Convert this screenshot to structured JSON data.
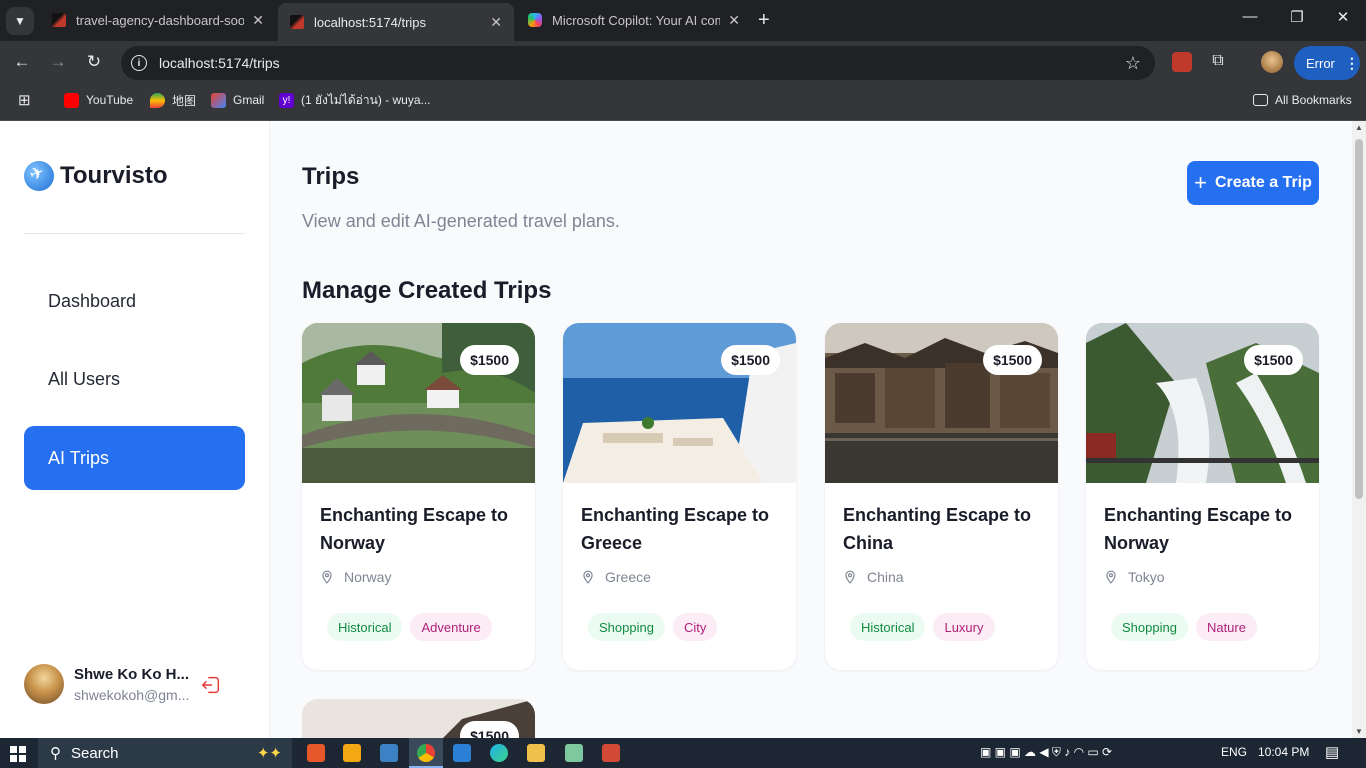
{
  "browser": {
    "tabs": [
      {
        "title": "travel-agency-dashboard-sooty",
        "close": "✕"
      },
      {
        "title": "localhost:5174/trips",
        "close": "✕"
      },
      {
        "title": "Microsoft Copilot: Your AI comp",
        "close": "✕"
      }
    ],
    "url": "localhost:5174/trips",
    "error_label": "Error",
    "bookmarks": [
      "YouTube",
      "地图",
      "Gmail",
      "(1 ยังไม่ได้อ่าน) - wuya...",
      "All Bookmarks"
    ]
  },
  "sidebar": {
    "brand": "Tourvisto",
    "items": [
      {
        "label": "Dashboard"
      },
      {
        "label": "All Users"
      },
      {
        "label": "AI Trips"
      }
    ],
    "user": {
      "name": "Shwe Ko Ko H...",
      "email": "shwekokoh@gm..."
    }
  },
  "header": {
    "title": "Trips",
    "subtitle": "View and edit AI-generated travel plans.",
    "create_button": "Create a Trip"
  },
  "section_title": "Manage Created Trips",
  "trips": [
    {
      "title_line1": "Enchanting Escape to",
      "title_line2": "Norway",
      "location": "Norway",
      "price": "$1500",
      "tags": [
        "Historical",
        "Adventure"
      ]
    },
    {
      "title_line1": "Enchanting Escape to",
      "title_line2": "Greece",
      "location": "Greece",
      "price": "$1500",
      "tags": [
        "Shopping",
        "City"
      ]
    },
    {
      "title_line1": "Enchanting Escape to",
      "title_line2": "China",
      "location": "China",
      "price": "$1500",
      "tags": [
        "Historical",
        "Luxury"
      ]
    },
    {
      "title_line1": "Enchanting Escape to",
      "title_line2": "Norway",
      "location": "Tokyo",
      "price": "$1500",
      "tags": [
        "Shopping",
        "Nature"
      ]
    }
  ],
  "partial_card_price": "$1500",
  "taskbar": {
    "search_label": "Search",
    "language": "ENG",
    "time": "10:04 PM"
  },
  "colors": {
    "accent": "#256ff1",
    "tag_green_bg": "#ecfbf1",
    "tag_green_text": "#0f8a3f",
    "tag_pink_bg": "#fbecf5",
    "tag_pink_text": "#b0227a"
  }
}
